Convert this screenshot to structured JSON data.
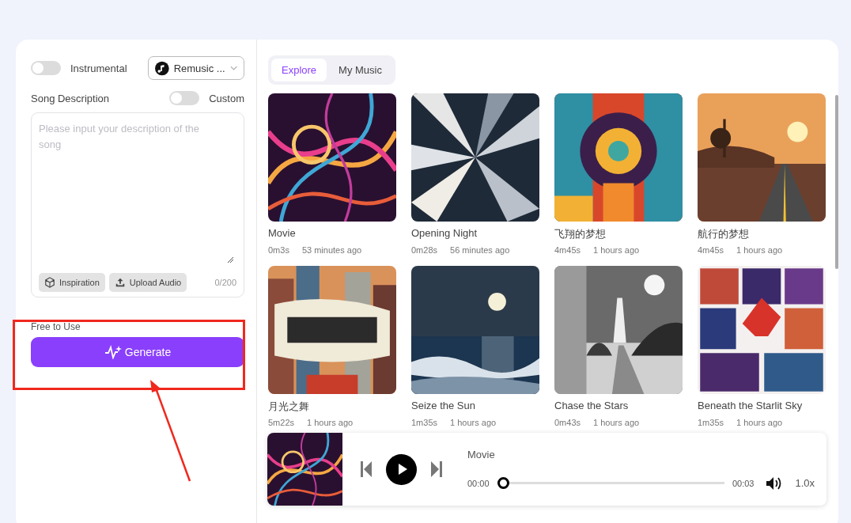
{
  "left_panel": {
    "instrumental": {
      "label": "Instrumental",
      "on": false
    },
    "model_select": {
      "value": "Remusic ..."
    },
    "description": {
      "label": "Song Description",
      "custom": {
        "label": "Custom",
        "on": false
      },
      "placeholder": "Please input your description of the song",
      "buttons": [
        "Inspiration",
        "Upload Audio"
      ],
      "counter": "0/200"
    },
    "free_note": "Free to Use",
    "generate_button": "Generate"
  },
  "tabs": [
    {
      "label": "Explore",
      "selected": true
    },
    {
      "label": "My Music",
      "selected": false
    }
  ],
  "songs": [
    {
      "title": "Movie",
      "duration": "0m3s",
      "age": "53 minutes ago"
    },
    {
      "title": "Opening Night",
      "duration": "0m28s",
      "age": "56 minutes ago"
    },
    {
      "title": "飞翔的梦想",
      "duration": "4m45s",
      "age": "1 hours ago"
    },
    {
      "title": "航行的梦想",
      "duration": "4m45s",
      "age": "1 hours ago"
    },
    {
      "title": "月光之舞",
      "duration": "5m22s",
      "age": "1 hours ago"
    },
    {
      "title": "Seize the Sun",
      "duration": "1m35s",
      "age": "1 hours ago"
    },
    {
      "title": "Chase the Stars",
      "duration": "0m43s",
      "age": "1 hours ago"
    },
    {
      "title": "Beneath the Starlit Sky",
      "duration": "1m35s",
      "age": "1 hours ago"
    }
  ],
  "player": {
    "title": "Movie",
    "current": "00:00",
    "total": "00:03",
    "level": 0,
    "speed": "1.0x"
  }
}
